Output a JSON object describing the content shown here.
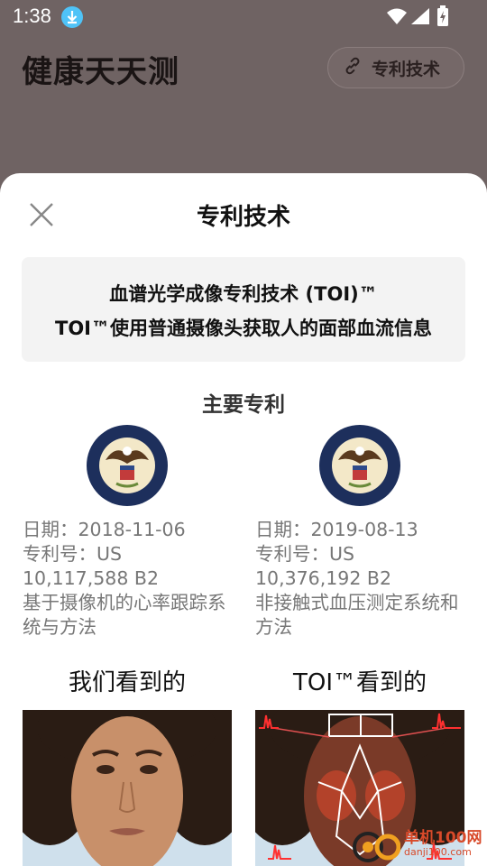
{
  "status_bar": {
    "time": "1:38"
  },
  "app": {
    "title": "健康天天测",
    "patent_chip_label": "专利技术"
  },
  "sheet": {
    "title": "专利技术",
    "intro_line1": "血谱光学成像专利技术 (TOI)™",
    "intro_line2": "TOI™使用普通摄像头获取人的面部血流信息",
    "section_title": "主要专利",
    "patents": [
      {
        "date": "日期：2018-11-06",
        "number_l1": "专利号：US",
        "number_l2": "10,117,588 B2",
        "desc": "基于摄像机的心率跟踪系统与方法"
      },
      {
        "date": "日期：2019-08-13",
        "number_l1": "专利号：US",
        "number_l2": "10,376,192 B2",
        "desc": "非接触式血压测定系统和方法"
      }
    ],
    "view_left_title": "我们看到的",
    "view_right_title": "TOI™看到的"
  },
  "watermark": {
    "text": "单机100网",
    "url": "danji100.com"
  }
}
